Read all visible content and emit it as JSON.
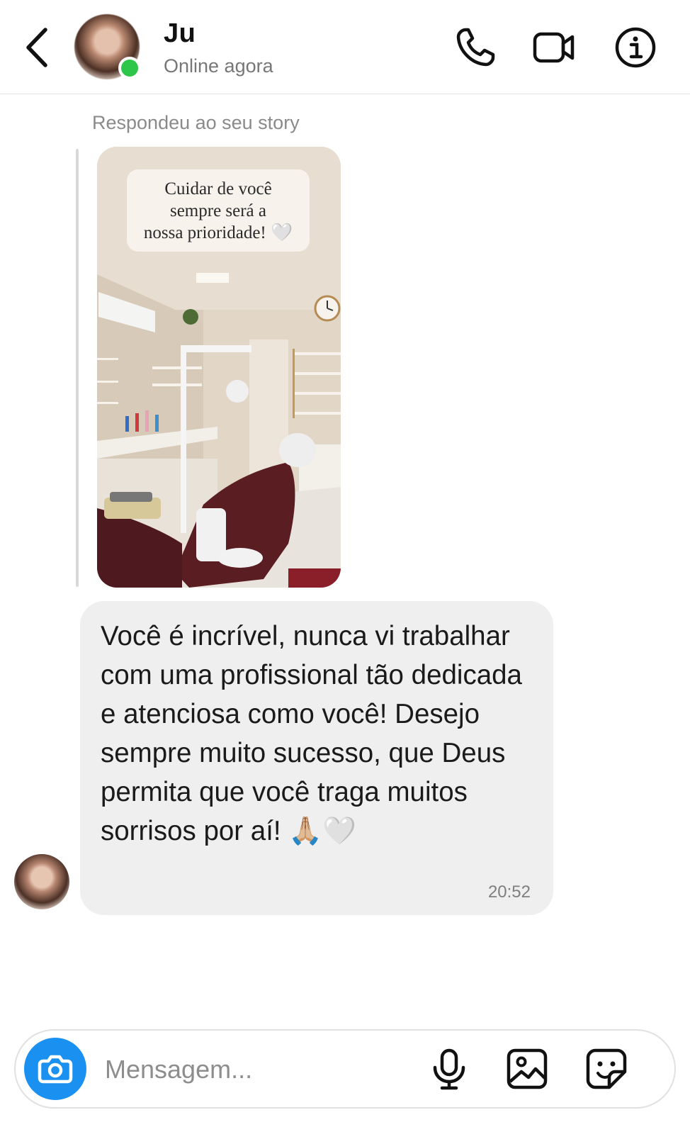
{
  "header": {
    "contact_name": "Ju",
    "status": "Online agora",
    "icons": [
      "back-chevron-icon",
      "phone-icon",
      "video-camera-icon",
      "info-icon"
    ],
    "online_indicator_color": "#2ec64a"
  },
  "story_reply": {
    "label": "Respondeu ao seu story",
    "caption_lines": [
      "Cuidar de você",
      "sempre será a",
      "nossa prioridade! 🤍"
    ]
  },
  "message": {
    "text": "Você é incrível, nunca vi trabalhar com uma profissional tão dedicada e atenciosa como você! Desejo sempre muito sucesso, que Deus permita que você traga muitos sorrisos por aí! 🙏🏼🤍",
    "time": "20:52"
  },
  "composer": {
    "placeholder": "Mensagem...",
    "value": "",
    "icons": [
      "camera-icon",
      "microphone-icon",
      "gallery-icon",
      "sticker-icon"
    ],
    "accent": "#1a91f0"
  },
  "colors": {
    "bubble_bg": "#efefef",
    "divider": "#e3e3e3"
  }
}
